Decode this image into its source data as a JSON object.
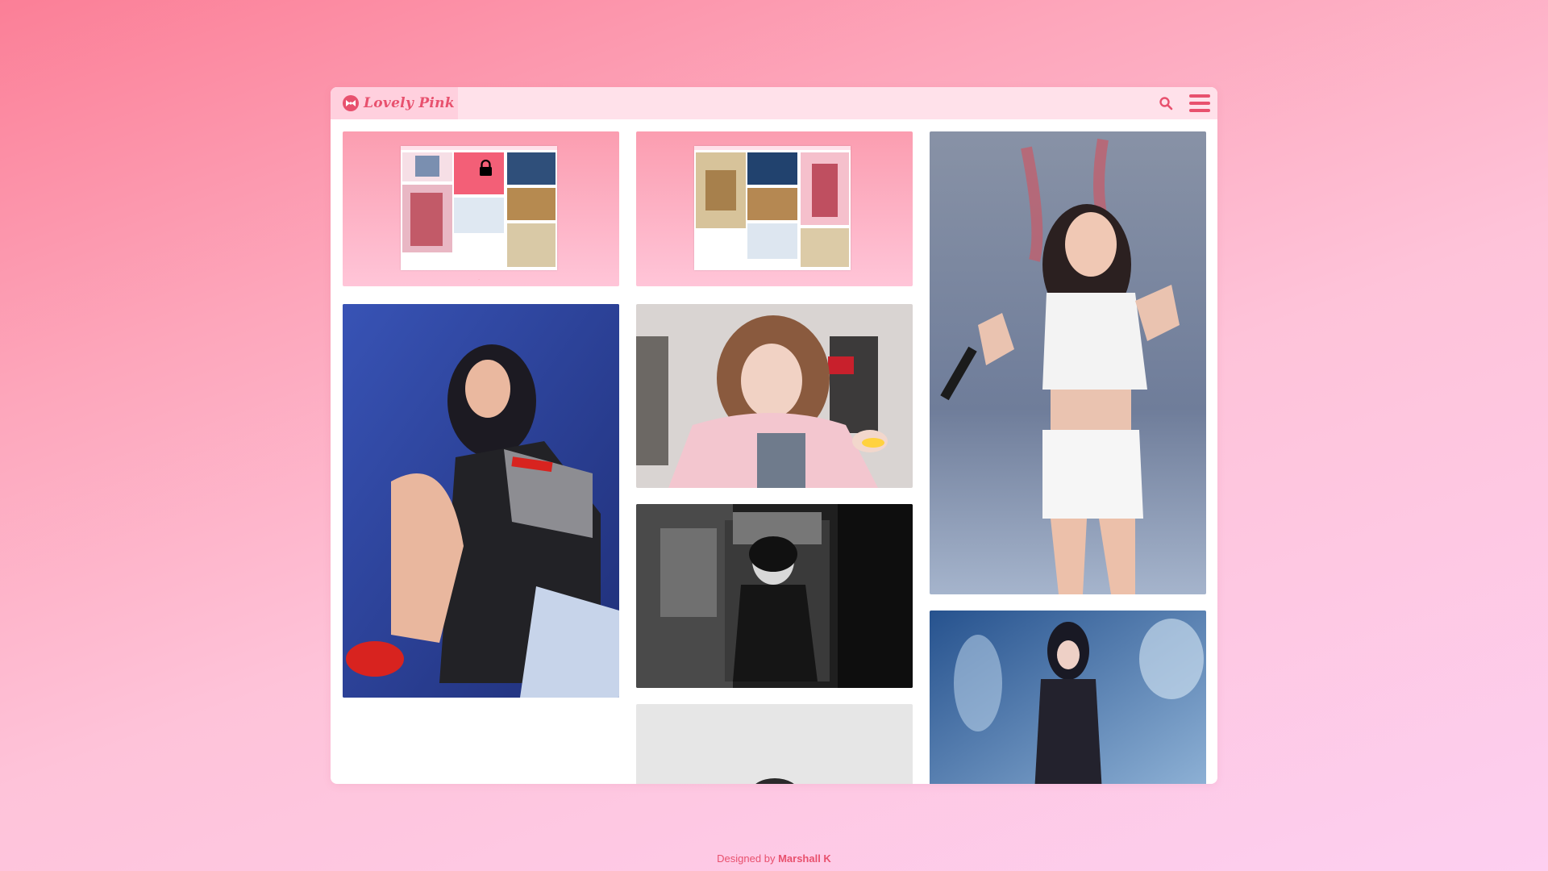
{
  "app": {
    "title": "Lovely Pink",
    "accent_color": "#e8516e",
    "topbar_color": "#ffe1ea"
  },
  "toolbar": {
    "search_icon": "search-icon",
    "menu_icon": "hamburger-menu-icon"
  },
  "gallery": {
    "columns": [
      [
        {
          "kind": "screenshot",
          "description_icon": "gallery-preview-locked"
        },
        {
          "kind": "photo",
          "caption": ""
        }
      ],
      [
        {
          "kind": "screenshot",
          "description_icon": "gallery-preview"
        },
        {
          "kind": "photo",
          "caption": ""
        },
        {
          "kind": "photo",
          "caption": ""
        },
        {
          "kind": "photo",
          "caption": ""
        }
      ],
      [
        {
          "kind": "photo",
          "caption": ""
        },
        {
          "kind": "photo",
          "caption": ""
        }
      ]
    ]
  },
  "footer": {
    "prefix": "Designed by",
    "author": "Marshall K"
  }
}
